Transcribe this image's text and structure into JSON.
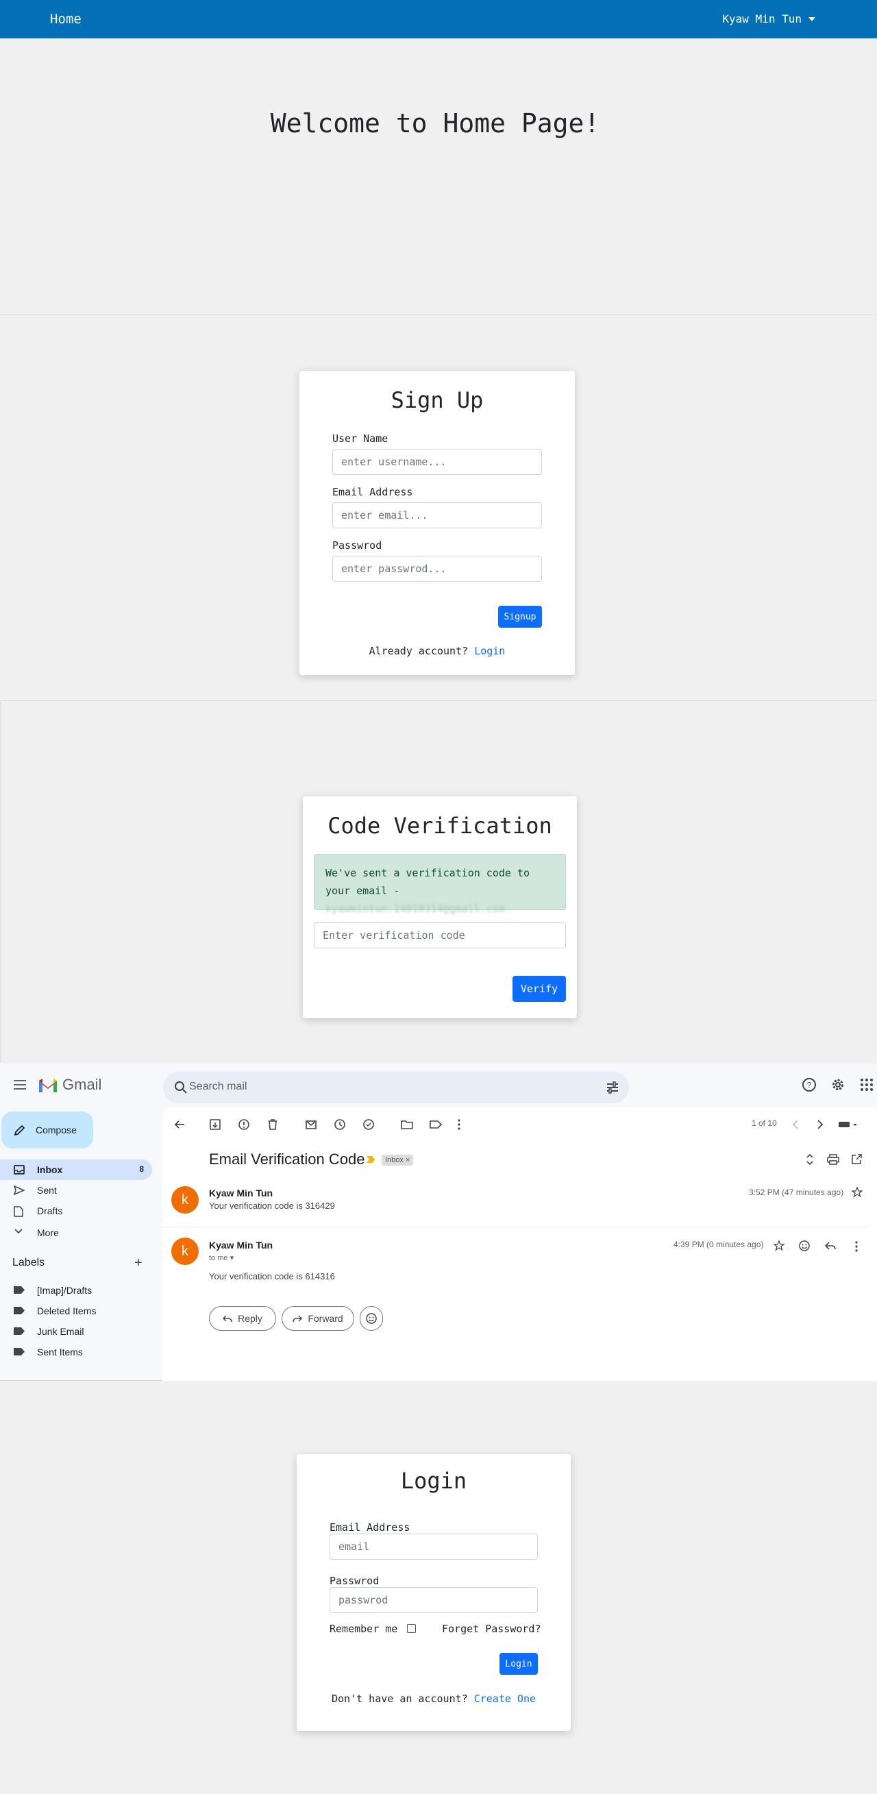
{
  "home": {
    "brand": "Home",
    "user_menu": "Kyaw Min Tun",
    "welcome": "Welcome to Home Page!"
  },
  "signup": {
    "title": "Sign Up",
    "username_label": "User Name",
    "username_placeholder": "enter username...",
    "email_label": "Email Address",
    "email_placeholder": "enter email...",
    "password_label": "Passwrod",
    "password_placeholder": "enter passwrod...",
    "button": "Signup",
    "footer_text": "Already account?",
    "footer_link": "Login"
  },
  "verify": {
    "title": "Code Verification",
    "message": "We've sent a verification code to your email -",
    "email_hidden": "kyawmintun.14010314@gmail.com",
    "input_placeholder": "Enter verification code",
    "button": "Verify"
  },
  "gmail": {
    "logo_text": "Gmail",
    "search_placeholder": "Search mail",
    "compose": "Compose",
    "nav": [
      {
        "label": "Inbox",
        "count": "8",
        "icon": "inbox-icon"
      },
      {
        "label": "Sent",
        "count": "",
        "icon": "send-icon"
      },
      {
        "label": "Drafts",
        "count": "",
        "icon": "draft-icon"
      },
      {
        "label": "More",
        "count": "",
        "icon": "chevron-down-icon"
      }
    ],
    "labels_heading": "Labels",
    "labels": [
      "[Imap]/Drafts",
      "Deleted Items",
      "Junk Email",
      "Sent Items"
    ],
    "pager": "1 of 10",
    "subject": "Email Verification Code",
    "chip": "Inbox",
    "chip_close": "×",
    "messages": [
      {
        "avatar": "k",
        "sender": "Kyaw Min Tun",
        "snippet": "Your verification code is 316429",
        "time": "3:52 PM (47 minutes ago)"
      },
      {
        "avatar": "k",
        "sender": "Kyaw Min Tun",
        "to": "to me",
        "snippet": "Your verification code is 614316",
        "time": "4:39 PM (0 minutes ago)"
      }
    ],
    "reply": "Reply",
    "forward": "Forward"
  },
  "login": {
    "title": "Login",
    "email_label": "Email Address",
    "email_placeholder": "email",
    "password_label": "Passwrod",
    "password_placeholder": "passwrod",
    "remember": "Remember me",
    "forgot": "Forget Password?",
    "button": "Login",
    "footer_text": "Don't have an account?",
    "footer_link": "Create One"
  },
  "colors": {
    "navbar": "#0470b8",
    "primary": "#0d6efd",
    "alert_bg": "#d1e7dd",
    "avatar": "#f06d00",
    "compose": "#c2e7ff"
  }
}
